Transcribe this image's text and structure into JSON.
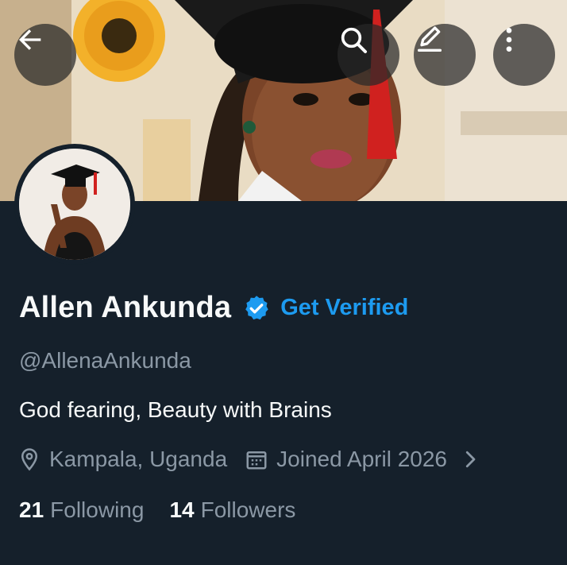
{
  "header": {
    "back_icon": "arrow-left-icon",
    "search_icon": "search-icon",
    "edit_icon": "pencil-icon",
    "more_icon": "more-vertical-icon"
  },
  "profile": {
    "name": "Allen Ankunda",
    "verified_badge": "verified-badge-icon",
    "get_verified_label": "Get Verified",
    "handle": "@AllenaAnkunda",
    "bio": "God fearing, Beauty with Brains",
    "location": "Kampala, Uganda",
    "joined": "Joined April 2026",
    "following_count": "21",
    "following_label": "Following",
    "followers_count": "14",
    "followers_label": "Followers"
  },
  "colors": {
    "background": "#15202b",
    "accent": "#1d9bf0",
    "secondary_text": "#8b98a5",
    "primary_text": "#f7f9f9"
  }
}
